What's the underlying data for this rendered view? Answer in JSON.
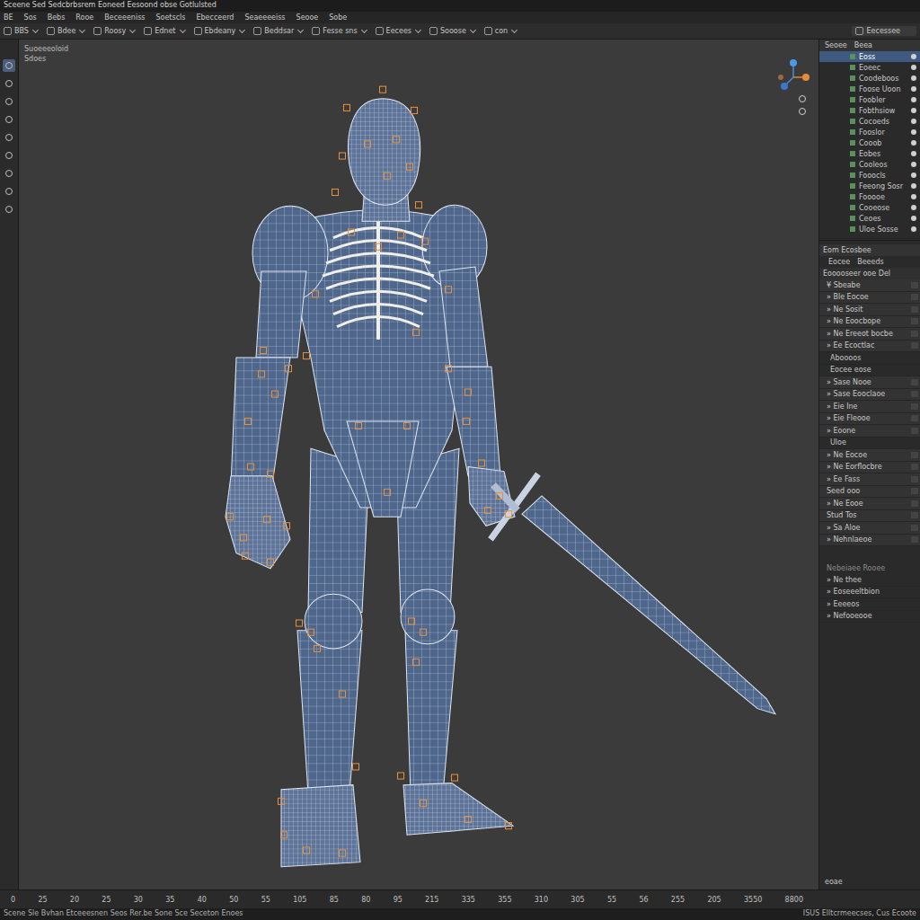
{
  "window": {
    "title": "Sceene Sed Sedcbrbsrem Eoneed Eesoond obse Gotlulsted"
  },
  "menu": [
    "BE",
    "Sos",
    "Bebs",
    "Rooe",
    "Beceeeniss",
    "Soetscls",
    "Ebecceerd",
    "Seaeeeeiss",
    "Seooe",
    "Sobe"
  ],
  "toolbar": {
    "items": [
      "BBS",
      "Bdee",
      "Roosy",
      "Ednet",
      "Ebdeany",
      "Beddsar",
      "Fesse sns",
      "Eecees",
      "Sooose",
      "con"
    ],
    "right": "Eecessee"
  },
  "tools": [
    {
      "selected": true
    },
    {
      "selected": false
    },
    {
      "selected": false
    },
    {
      "selected": false
    },
    {
      "selected": false
    },
    {
      "selected": false
    },
    {
      "selected": false
    },
    {
      "selected": false
    },
    {
      "selected": false
    }
  ],
  "viewport": {
    "labels": [
      "Suoeeeoloid",
      "Sdoes"
    ]
  },
  "outliner": {
    "tabs": [
      "Seoee",
      "Beea"
    ],
    "items": [
      {
        "label": "Eoss",
        "selected": true
      },
      {
        "label": "Eoeec",
        "selected": false
      },
      {
        "label": "Coodeboos",
        "selected": false
      },
      {
        "label": "Foose Uoon",
        "selected": false
      },
      {
        "label": "Foobler",
        "selected": false
      },
      {
        "label": "Fobthsiow",
        "selected": false
      },
      {
        "label": "Cocoeds",
        "selected": false
      },
      {
        "label": "Fooslor",
        "selected": false
      },
      {
        "label": "Cooob",
        "selected": false
      },
      {
        "label": "Eobes",
        "selected": false
      },
      {
        "label": "Cooleos",
        "selected": false
      },
      {
        "label": "Fooocls",
        "selected": false
      },
      {
        "label": "Feeong Sosr",
        "selected": false
      },
      {
        "label": "Fooooe",
        "selected": false
      },
      {
        "label": "Cooeose",
        "selected": false
      },
      {
        "label": "Ceoes",
        "selected": false
      },
      {
        "label": "Uloe Sosse",
        "selected": false
      }
    ]
  },
  "properties": {
    "header": "Eom Ecosbee",
    "tabs": [
      "Eocee",
      "Beeeds"
    ],
    "subheader": "Eooooseer ooe Del",
    "rows": [
      {
        "label": "¥ Sbeabe",
        "kind": "field"
      },
      {
        "label": "» Ble Eocoe",
        "kind": "field"
      },
      {
        "label": "» Ne Sosit",
        "kind": "field"
      },
      {
        "label": "» Ne Eoocbope",
        "kind": "field"
      },
      {
        "label": "» Ne Ereeot bocbe",
        "kind": "field"
      },
      {
        "label": "» Ee Ecoctlac",
        "kind": "field"
      },
      {
        "label": "Aboooos",
        "kind": "header"
      },
      {
        "label": "Eocee eose",
        "kind": "header"
      },
      {
        "label": "» Sase Nooe",
        "kind": "field"
      },
      {
        "label": "» Sase Eooclaoe",
        "kind": "field"
      },
      {
        "label": "» Eie Ine",
        "kind": "field"
      },
      {
        "label": "» Eie Fleooe",
        "kind": "field"
      },
      {
        "label": "» Eoone",
        "kind": "field"
      },
      {
        "label": "Uloe",
        "kind": "header"
      },
      {
        "label": "» Ne Eocoe",
        "kind": "field"
      },
      {
        "label": "» Ne Eorflocbre",
        "kind": "field"
      },
      {
        "label": "» Ee Fass",
        "kind": "field"
      },
      {
        "label": "Seed ooo",
        "kind": "field"
      },
      {
        "label": "» Ne Eooe",
        "kind": "field"
      },
      {
        "label": "Stud Tos",
        "kind": "field"
      },
      {
        "label": "» Sa Aloe",
        "kind": "field"
      },
      {
        "label": "» Nehnlaeoe",
        "kind": "field"
      }
    ],
    "extra": {
      "header": "Nebeiaee Rooee",
      "rows": [
        "» Ne thee",
        "» Eoseeeltbion",
        "» Eeeeos",
        "» Nefooeooe"
      ]
    },
    "footer": "eoae"
  },
  "timeline": {
    "ticks": [
      "0",
      "25",
      "20",
      "25",
      "30",
      "35",
      "40",
      "50",
      "55",
      "105",
      "85",
      "80",
      "95",
      "215",
      "335",
      "355",
      "310",
      "305",
      "55",
      "56",
      "255",
      "205",
      "3550",
      "8800"
    ]
  },
  "status_bar": {
    "left": "Scene Sle Bvhan Etceeesnen Seos Rer.be Sone Sce Seceton Enoes",
    "right": "ISUS Elltcrmeecses, Cus Ecoote"
  }
}
